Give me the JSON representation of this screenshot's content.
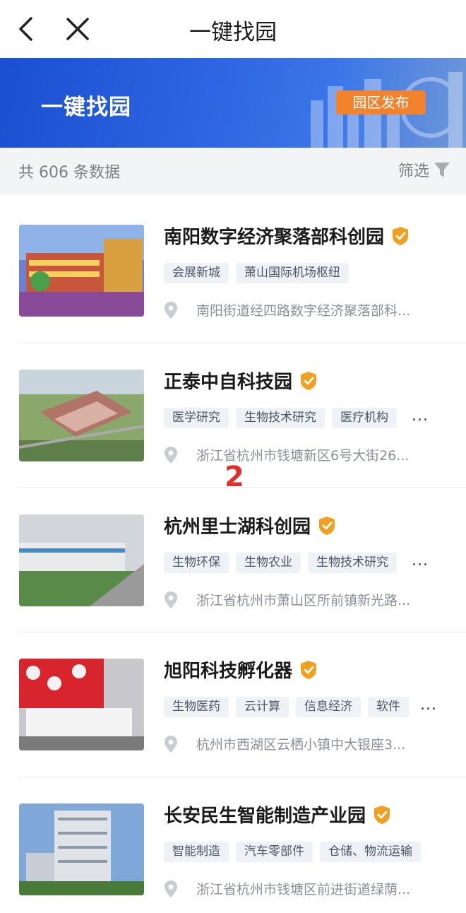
{
  "nav": {
    "title": "一键找园",
    "back_icon": "chevron-left-icon",
    "close_icon": "close-icon"
  },
  "banner": {
    "title": "一键找园",
    "publish_label": "园区发布"
  },
  "summary": {
    "count_text": "共 606 条数据",
    "filter_label": "筛选"
  },
  "annotation": "2",
  "parks": [
    {
      "name": "南阳数字经济聚落部科创园",
      "tags": [
        "会展新城",
        "萧山国际机场枢纽"
      ],
      "more": "",
      "address": "南阳街道经四路数字经济聚落部科..."
    },
    {
      "name": "正泰中自科技园",
      "tags": [
        "医学研究",
        "生物技术研究",
        "医疗机构"
      ],
      "more": "...",
      "address": "浙江省杭州市钱塘新区6号大街26..."
    },
    {
      "name": "杭州里士湖科创园",
      "tags": [
        "生物环保",
        "生物农业",
        "生物技术研究"
      ],
      "more": "...",
      "address": "浙江省杭州市萧山区所前镇新光路..."
    },
    {
      "name": "旭阳科技孵化器",
      "tags": [
        "生物医药",
        "云计算",
        "信息经济",
        "软件"
      ],
      "more": "...",
      "address": "杭州市西湖区云栖小镇中大银座3..."
    },
    {
      "name": "长安民生智能制造产业园",
      "tags": [
        "智能制造",
        "汽车零部件",
        "仓储、物流运输"
      ],
      "more": "",
      "address": "浙江省杭州市钱塘区前进街道绿荫..."
    }
  ],
  "colors": {
    "banner": "#2a63e0",
    "publish": "#f2822c",
    "badge": "#f0a020",
    "annotation": "#e0302a"
  }
}
